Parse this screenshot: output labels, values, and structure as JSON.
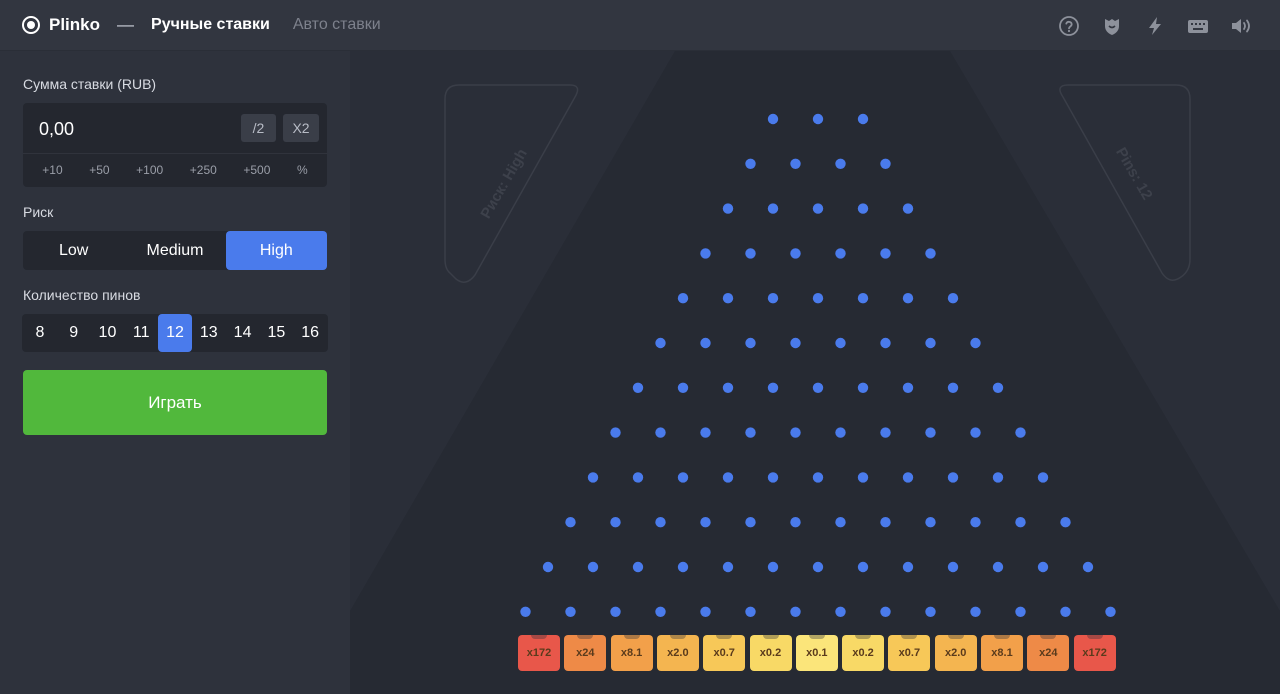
{
  "header": {
    "brand": "Plinko",
    "separator": "—",
    "tab_manual": "Ручные ставки",
    "tab_auto": "Авто ставки",
    "icons": [
      "help-icon",
      "shield-icon",
      "lightning-icon",
      "keyboard-icon",
      "volume-icon"
    ]
  },
  "sidebar": {
    "bet_label": "Сумма ставки (RUB)",
    "bet_value": "0,00",
    "half_label": "/2",
    "double_label": "X2",
    "quick_amounts": [
      "+10",
      "+50",
      "+100",
      "+250",
      "+500",
      "%"
    ],
    "risk_label": "Риск",
    "risk_options": [
      "Low",
      "Medium",
      "High"
    ],
    "risk_selected": "High",
    "pins_label": "Количество пинов",
    "pin_options": [
      "8",
      "9",
      "10",
      "11",
      "12",
      "13",
      "14",
      "15",
      "16"
    ],
    "pins_selected": "12",
    "play_label": "Играть"
  },
  "board": {
    "risk_card": "Риск: High",
    "pins_card": "Pins: 12",
    "pin_color": "#4a7bec",
    "multipliers": [
      "x172",
      "x24",
      "x8.1",
      "x2.0",
      "x0.7",
      "x0.2",
      "x0.1",
      "x0.2",
      "x0.7",
      "x2.0",
      "x8.1",
      "x24",
      "x172"
    ],
    "multiplier_colors": [
      "#e8574a",
      "#ee8a47",
      "#f2a04a",
      "#f4b550",
      "#f7c858",
      "#f8d966",
      "#fbe57a",
      "#f8d966",
      "#f7c858",
      "#f4b550",
      "#f2a04a",
      "#ee8a47",
      "#e8574a"
    ]
  }
}
